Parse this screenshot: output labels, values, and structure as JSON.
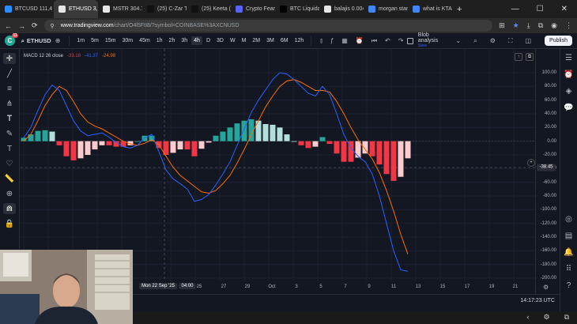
{
  "browser": {
    "tabs": [
      {
        "label": "BTCUSD 111,4",
        "active": false,
        "color": "#2a8cff"
      },
      {
        "label": "ETHUSD 3,",
        "active": true,
        "color": "#e6e6e6"
      },
      {
        "label": "MSTR 304.79",
        "active": false,
        "color": "#e6e6e6"
      },
      {
        "label": "(25) C-Zar The",
        "active": false,
        "color": "#111111"
      },
      {
        "label": "(25) Keeta (@",
        "active": false,
        "color": "#111111"
      },
      {
        "label": "Crypto Fear an",
        "active": false,
        "color": "#5865f2"
      },
      {
        "label": "BTC Liquidati",
        "active": false,
        "color": "#000000"
      },
      {
        "label": "balajis 0.004",
        "active": false,
        "color": "#e6e6e6"
      },
      {
        "label": "morgan stanle",
        "active": false,
        "color": "#4285f4"
      },
      {
        "label": "what is KTA k",
        "active": false,
        "color": "#4285f4"
      }
    ],
    "url_host": "www.tradingview.com",
    "url_path": "/chart/O4l5FtI8/?symbol=COINBASE%3AXCNUSD"
  },
  "toolbar": {
    "logo_badge": "11",
    "symbol": "ETHUSD",
    "timeframes": [
      "1m",
      "5m",
      "15m",
      "30m",
      "45m",
      "1h",
      "2h",
      "3h",
      "4h",
      "D",
      "3D",
      "W",
      "M",
      "2M",
      "3M",
      "6M",
      "12h"
    ],
    "active_timeframe": "4h",
    "brief_label": "Blob analysis",
    "brief_sub": "Save",
    "publish_label": "Publish"
  },
  "legend": {
    "name": "MACD 12 26 close",
    "hist": "-33.18",
    "macd": "-41.37",
    "signal": "-24.98",
    "hist_color": "#f23645",
    "macd_color": "#2962ff",
    "signal_color": "#ff6d00"
  },
  "y_axis": [
    "100.00",
    "80.00",
    "60.00",
    "40.00",
    "20.00",
    "0.00",
    "-20.00",
    "-40.00",
    "-60.00",
    "-80.00",
    "-100.00",
    "-120.00",
    "-140.00",
    "-160.00",
    "-180.00",
    "-200.00"
  ],
  "crosshair_value": "-38.45",
  "x_axis": [
    {
      "label": "Mon 22 Sep '25",
      "hl": true
    },
    {
      "label": "04:00",
      "hl": true
    },
    {
      "label": "25",
      "hl": false
    },
    {
      "label": "27",
      "hl": false
    },
    {
      "label": "29",
      "hl": false
    },
    {
      "label": "Oct",
      "hl": false
    },
    {
      "label": "3",
      "hl": false
    },
    {
      "label": "5",
      "hl": false
    },
    {
      "label": "7",
      "hl": false
    },
    {
      "label": "9",
      "hl": false
    },
    {
      "label": "11",
      "hl": false
    },
    {
      "label": "13",
      "hl": false
    },
    {
      "label": "15",
      "hl": false
    },
    {
      "label": "17",
      "hl": false
    },
    {
      "label": "19",
      "hl": false
    },
    {
      "label": "21",
      "hl": false
    }
  ],
  "clock": "14:17:23 UTC",
  "chart_data": {
    "type": "line",
    "x_start_index": 0,
    "macd": [
      5,
      20,
      45,
      68,
      82,
      74,
      52,
      30,
      15,
      8,
      10,
      12,
      6,
      -2,
      -8,
      -10,
      -6,
      5,
      10,
      -15,
      -42,
      -55,
      -62,
      -70,
      -88,
      -85,
      -78,
      -64,
      -48,
      -30,
      -6,
      18,
      42,
      60,
      75,
      90,
      100,
      98,
      90,
      80,
      70,
      66,
      80,
      68,
      40,
      10,
      -10,
      -22,
      -30,
      -48,
      -80,
      -120,
      -160,
      -188,
      -190
    ],
    "signal": [
      0,
      10,
      30,
      52,
      68,
      80,
      74,
      58,
      40,
      28,
      22,
      18,
      12,
      6,
      0,
      -4,
      -6,
      -3,
      2,
      -5,
      -22,
      -38,
      -50,
      -58,
      -66,
      -74,
      -76,
      -72,
      -62,
      -50,
      -32,
      -12,
      10,
      30,
      50,
      66,
      80,
      88,
      90,
      86,
      80,
      74,
      74,
      72,
      58,
      40,
      20,
      2,
      -12,
      -26,
      -46,
      -72,
      -102,
      -136,
      -165
    ],
    "histogram": [
      5,
      10,
      15,
      16,
      14,
      -6,
      -22,
      -28,
      -25,
      -20,
      -12,
      -6,
      -6,
      -8,
      -8,
      -6,
      0,
      8,
      8,
      -10,
      -20,
      -17,
      -12,
      -12,
      -22,
      -11,
      -2,
      8,
      14,
      20,
      26,
      30,
      32,
      30,
      25,
      24,
      20,
      10,
      0,
      -6,
      -10,
      -8,
      6,
      -4,
      -18,
      -30,
      -30,
      -24,
      -18,
      -22,
      -34,
      -48,
      -58,
      -52,
      -25
    ],
    "ylim": [
      -200,
      100
    ],
    "hist_pos_color": "#26a69a",
    "hist_pos_fade": "#b2dfdb",
    "hist_neg_color": "#f23645",
    "hist_neg_fade": "#fccbcd"
  }
}
